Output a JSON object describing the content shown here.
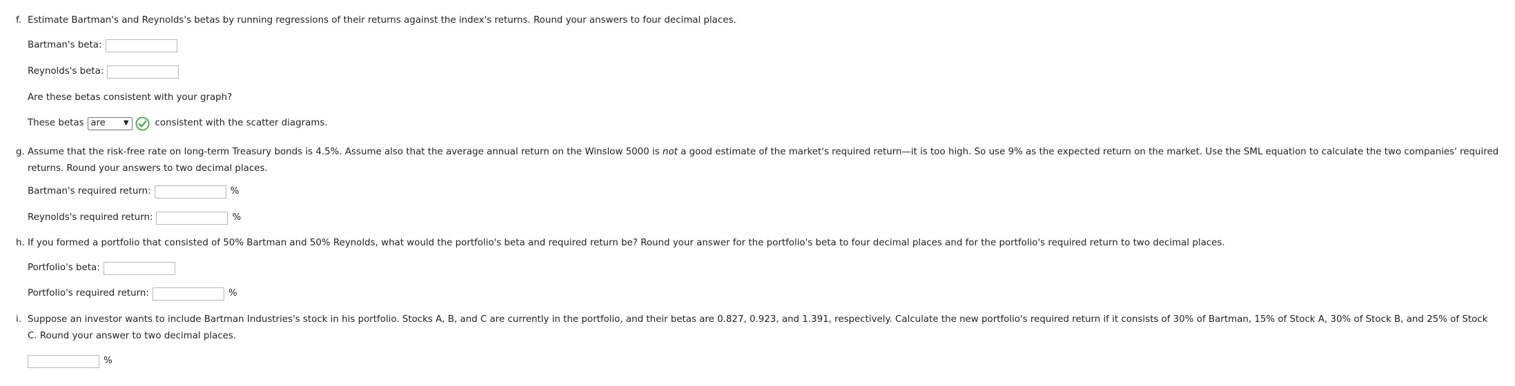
{
  "f": {
    "letter": "f.",
    "question": "Estimate Bartman's and Reynolds's betas by running regressions of their returns against the index's returns. Round your answers to four decimal places.",
    "bartman_label": "Bartman's beta:",
    "reynolds_label": "Reynolds's beta:",
    "consistency_question": "Are these betas consistent with your graph?",
    "betas_prefix": "These betas",
    "select_value": "are",
    "betas_suffix": "consistent with the scatter diagrams."
  },
  "g": {
    "letter": "g.",
    "question_part1": "Assume that the risk-free rate on long-term Treasury bonds is 4.5%. Assume also that the average annual return on the Winslow 5000 is ",
    "question_em": "not",
    "question_part2": " a good estimate of the market's required return—it is too high. So use 9% as the expected return on the market. Use the SML equation to calculate the two companies' required",
    "question_line2": "returns. Round your answers to two decimal places.",
    "bartman_label": "Bartman's required return:",
    "reynolds_label": "Reynolds's required return:",
    "unit": "%"
  },
  "h": {
    "letter": "h.",
    "question": "If you formed a portfolio that consisted of 50% Bartman and 50% Reynolds, what would the portfolio's beta and required return be? Round your answer for the portfolio's beta to four decimal places and for the portfolio's required return to two decimal places.",
    "beta_label": "Portfolio's beta:",
    "return_label": "Portfolio's required return:",
    "unit": "%"
  },
  "i": {
    "letter": "i.",
    "question_line1": "Suppose an investor wants to include Bartman Industries's stock in his portfolio. Stocks A, B, and C are currently in the portfolio, and their betas are 0.827, 0.923, and 1.391, respectively. Calculate the new portfolio's required return if it consists of 30% of Bartman, 15% of Stock A, 30% of Stock B, and 25% of Stock",
    "question_line2": "C. Round your answer to two decimal places.",
    "unit": "%"
  }
}
